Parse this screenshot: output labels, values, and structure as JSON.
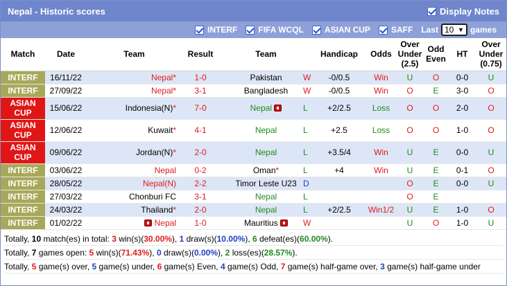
{
  "title": "Nepal - Historic scores",
  "display_notes": "Display Notes",
  "filters": {
    "interf": "INTERF",
    "fifa": "FIFA WCQL",
    "asian": "ASIAN CUP",
    "saff": "SAFF",
    "last_label": "Last",
    "last_value": "10",
    "games_label": "games"
  },
  "headers": {
    "match": "Match",
    "date": "Date",
    "team": "Team",
    "result": "Result",
    "team2": "Team",
    "handicap": "Handicap",
    "odds": "Odds",
    "ou25_1": "Over",
    "ou25_2": "Under",
    "ou25_3": "(2.5)",
    "oe_1": "Odd",
    "oe_2": "Even",
    "ht": "HT",
    "ou075_1": "Over",
    "ou075_2": "Under",
    "ou075_3": "(0.75)"
  },
  "rows": [
    {
      "league": "INTERF",
      "league2": "",
      "date": "16/11/22",
      "home": "Nepal",
      "home_star": "*",
      "home_card": false,
      "score": "1-0",
      "away": "Pakistan",
      "away_star": "",
      "away_card": false,
      "wdl": "W",
      "hcp": "-0/0.5",
      "odds": "Win",
      "ou": "U",
      "oe": "O",
      "ht": "0-0",
      "ou075": "U"
    },
    {
      "league": "INTERF",
      "league2": "",
      "date": "27/09/22",
      "home": "Nepal",
      "home_star": "*",
      "home_card": false,
      "score": "3-1",
      "away": "Bangladesh",
      "away_star": "",
      "away_card": false,
      "wdl": "W",
      "hcp": "-0/0.5",
      "odds": "Win",
      "ou": "O",
      "oe": "E",
      "ht": "3-0",
      "ou075": "O"
    },
    {
      "league": "ASIAN",
      "league2": "CUP",
      "date": "15/06/22",
      "home": "Indonesia(N)",
      "home_star": "*",
      "home_card": false,
      "score": "7-0",
      "away": "Nepal",
      "away_star": "",
      "away_card": true,
      "wdl": "L",
      "hcp": "+2/2.5",
      "odds": "Loss",
      "ou": "O",
      "oe": "O",
      "ht": "2-0",
      "ou075": "O"
    },
    {
      "league": "ASIAN",
      "league2": "CUP",
      "date": "12/06/22",
      "home": "Kuwait",
      "home_star": "*",
      "home_card": false,
      "score": "4-1",
      "away": "Nepal",
      "away_star": "",
      "away_card": false,
      "wdl": "L",
      "hcp": "+2.5",
      "odds": "Loss",
      "ou": "O",
      "oe": "O",
      "ht": "1-0",
      "ou075": "O"
    },
    {
      "league": "ASIAN",
      "league2": "CUP",
      "date": "09/06/22",
      "home": "Jordan(N)",
      "home_star": "*",
      "home_card": false,
      "score": "2-0",
      "away": "Nepal",
      "away_star": "",
      "away_card": false,
      "wdl": "L",
      "hcp": "+3.5/4",
      "odds": "Win",
      "ou": "U",
      "oe": "E",
      "ht": "0-0",
      "ou075": "U"
    },
    {
      "league": "INTERF",
      "league2": "",
      "date": "03/06/22",
      "home": "Nepal",
      "home_star": "",
      "home_card": false,
      "score": "0-2",
      "away": "Oman",
      "away_star": "*",
      "away_card": false,
      "wdl": "L",
      "hcp": "+4",
      "odds": "Win",
      "ou": "U",
      "oe": "E",
      "ht": "0-1",
      "ou075": "O"
    },
    {
      "league": "INTERF",
      "league2": "",
      "date": "28/05/22",
      "home": "Nepal(N)",
      "home_star": "",
      "home_card": false,
      "score": "2-2",
      "away": "Timor Leste U23",
      "away_star": "",
      "away_card": false,
      "wdl": "D",
      "hcp": "",
      "odds": "",
      "ou": "O",
      "oe": "E",
      "ht": "0-0",
      "ou075": "U"
    },
    {
      "league": "INTERF",
      "league2": "",
      "date": "27/03/22",
      "home": "Chonburi FC",
      "home_star": "",
      "home_card": false,
      "score": "3-1",
      "away": "Nepal",
      "away_star": "",
      "away_card": false,
      "wdl": "L",
      "hcp": "",
      "odds": "",
      "ou": "O",
      "oe": "E",
      "ht": "",
      "ou075": ""
    },
    {
      "league": "INTERF",
      "league2": "",
      "date": "24/03/22",
      "home": "Thailand",
      "home_star": "*",
      "home_card": false,
      "score": "2-0",
      "away": "Nepal",
      "away_star": "",
      "away_card": false,
      "wdl": "L",
      "hcp": "+2/2.5",
      "odds": "Win1/2",
      "ou": "U",
      "oe": "E",
      "ht": "1-0",
      "ou075": "O"
    },
    {
      "league": "INTERF",
      "league2": "",
      "date": "01/02/22",
      "home": "Nepal",
      "home_star": "",
      "home_card": true,
      "score": "1-0",
      "away": "Mauritius",
      "away_star": "",
      "away_card": true,
      "wdl": "W",
      "hcp": "",
      "odds": "",
      "ou": "U",
      "oe": "O",
      "ht": "1-0",
      "ou075": "U"
    }
  ],
  "summary": {
    "line1": [
      "Totally, ",
      "10",
      " match(es) in total: ",
      "3",
      " win(s)(",
      "30.00%",
      "), ",
      "1",
      " draw(s)(",
      "10.00%",
      "), ",
      "6",
      " defeat(es)(",
      "60.00%",
      ")."
    ],
    "line2": [
      "Totally, ",
      "7",
      " games open: ",
      "5",
      " win(s)(",
      "71.43%",
      "), ",
      "0",
      " draw(s)(",
      "0.00%",
      "), ",
      "2",
      " loss(es)(",
      "28.57%",
      ")."
    ],
    "line3": [
      "Totally, ",
      "5",
      " game(s) over, ",
      "5",
      " game(s) under, ",
      "6",
      " game(s) Even, ",
      "4",
      " game(s) Odd, ",
      "7",
      " game(s) half-game over, ",
      "3",
      " game(s) half-game under"
    ]
  },
  "colors": {
    "title_bg": "#6f86cc",
    "filter_bg": "#8ea0d8",
    "interf": "#a8a85a",
    "asian": "#e01616",
    "row_alt": "#dde6f6",
    "win": "#e01b1b",
    "loss": "#1f8a1f",
    "draw": "#1d3fbf"
  }
}
